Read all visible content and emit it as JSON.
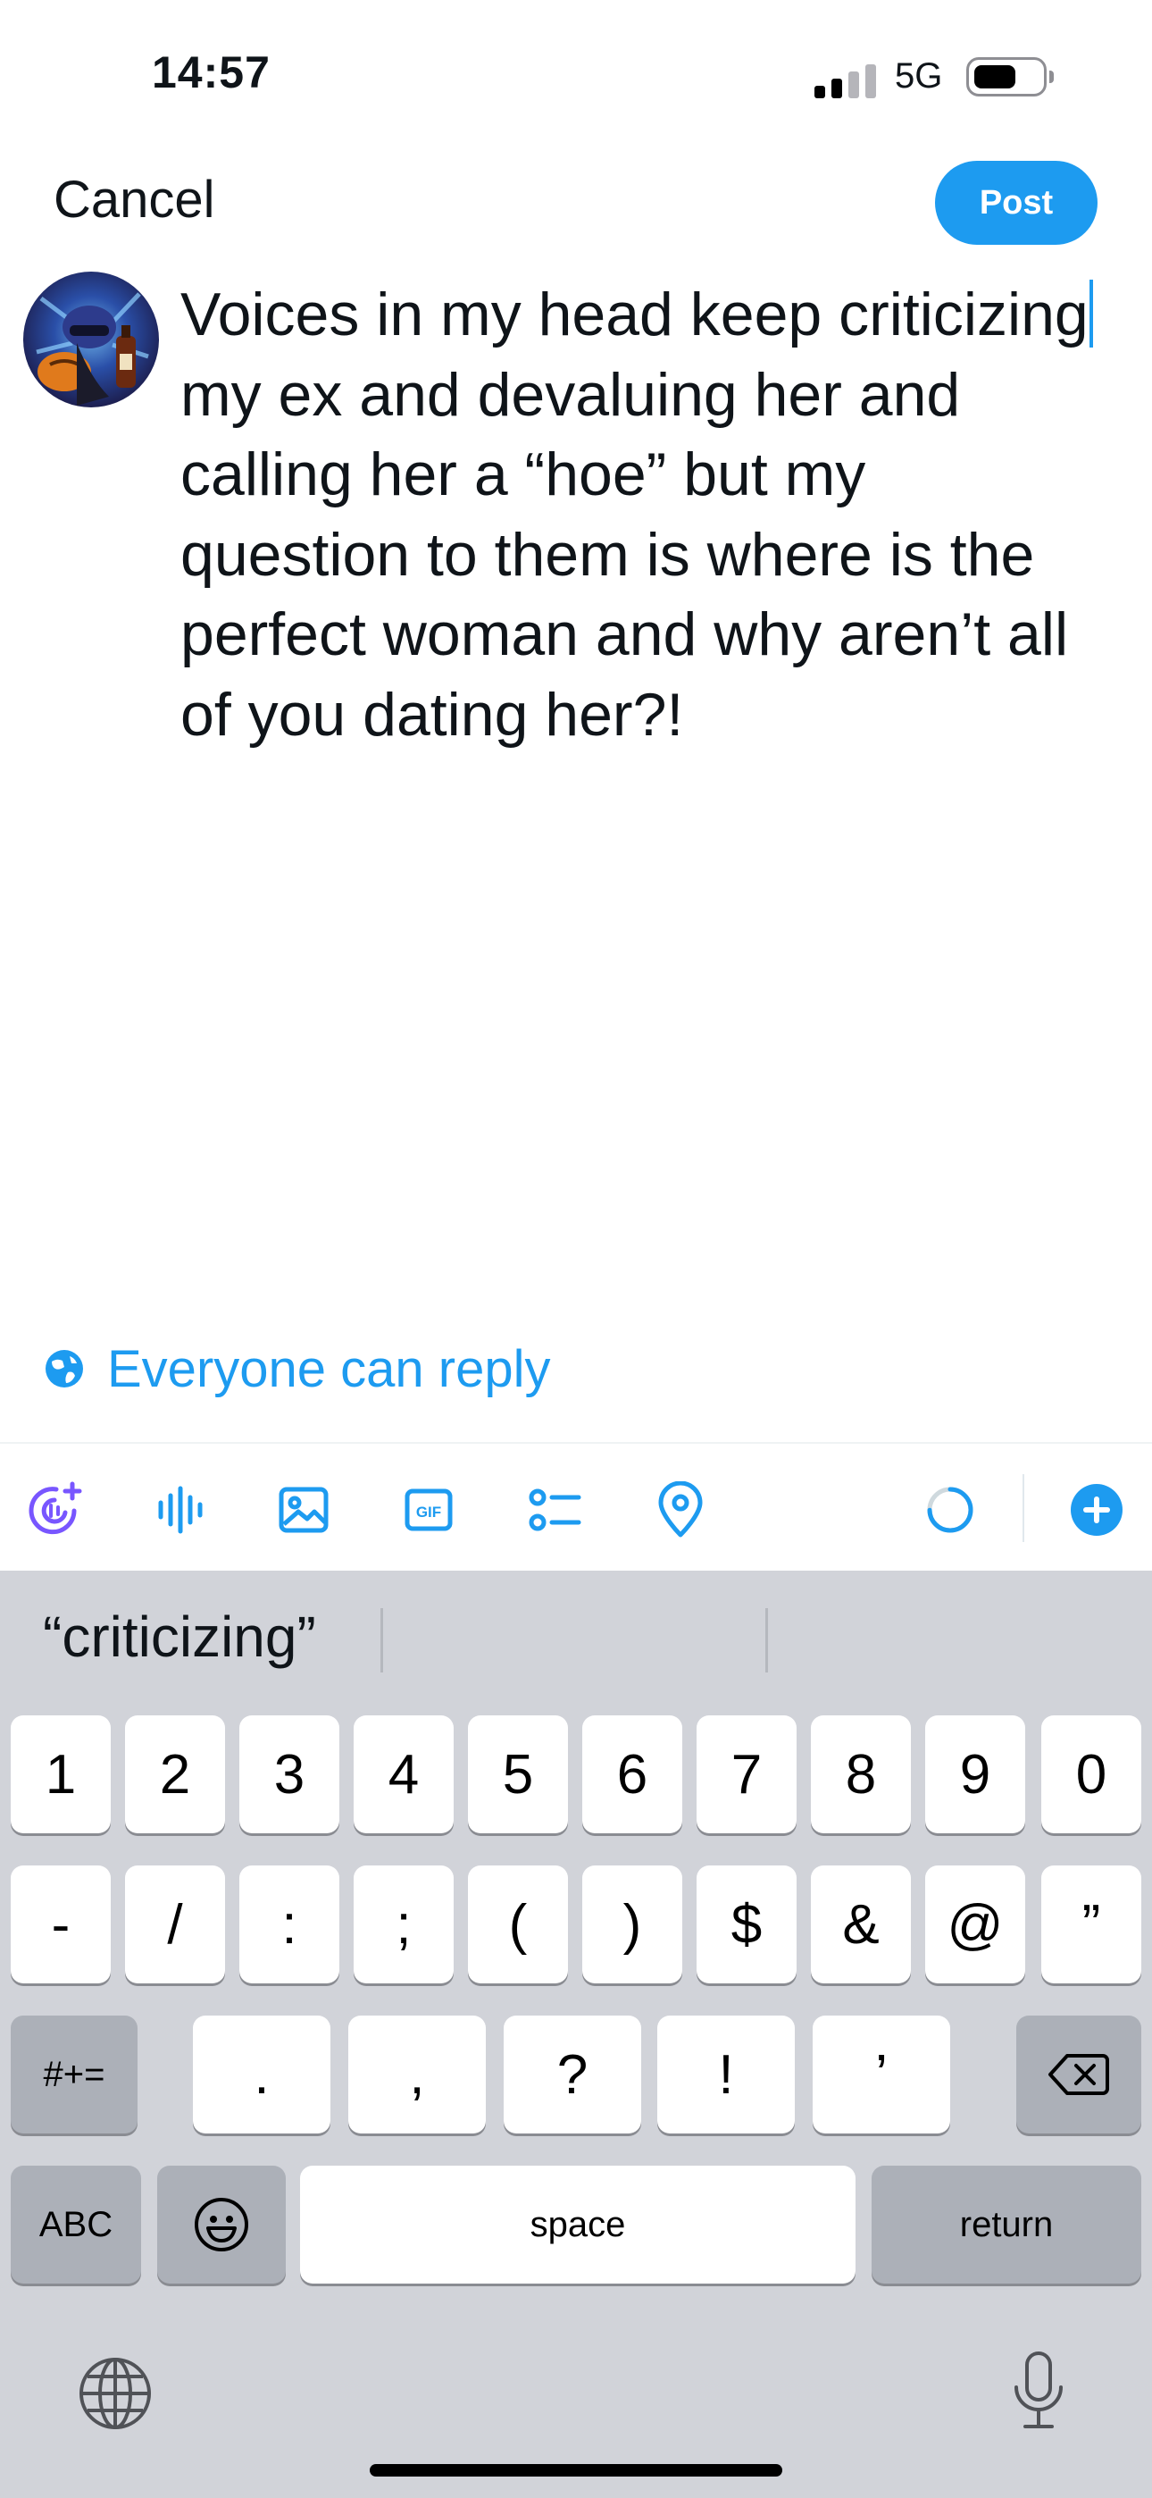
{
  "status_bar": {
    "time": "14:57",
    "network": "5G"
  },
  "header": {
    "cancel_label": "Cancel",
    "post_label": "Post"
  },
  "compose": {
    "text_before_cursor": "Voices in my head keep criticizing",
    "text_after_cursor": " my ex and devaluing her and calling her a “hoe” but my question to them is where is the perfect woman and why aren’t all of you dating her?!"
  },
  "reply_setting": {
    "label": "Everyone can reply",
    "icon": "globe-icon"
  },
  "toolbar": {
    "icons": [
      "grok-voice-icon",
      "audio-icon",
      "image-icon",
      "gif-icon",
      "poll-icon",
      "location-icon",
      "character-count-ring",
      "add-post-icon"
    ],
    "gif_text": "GIF",
    "accent_color": "#1d9bf0"
  },
  "keyboard": {
    "suggestion": "“criticizing”",
    "row1": [
      "1",
      "2",
      "3",
      "4",
      "5",
      "6",
      "7",
      "8",
      "9",
      "0"
    ],
    "row2": [
      "-",
      "/",
      ":",
      ";",
      "(",
      ")",
      "$",
      "&",
      "@",
      "”"
    ],
    "row3": [
      ".",
      ",",
      "?",
      "!",
      "’"
    ],
    "symbols_toggle": "#+=",
    "abc_label": "ABC",
    "space_label": "space",
    "return_label": "return"
  }
}
